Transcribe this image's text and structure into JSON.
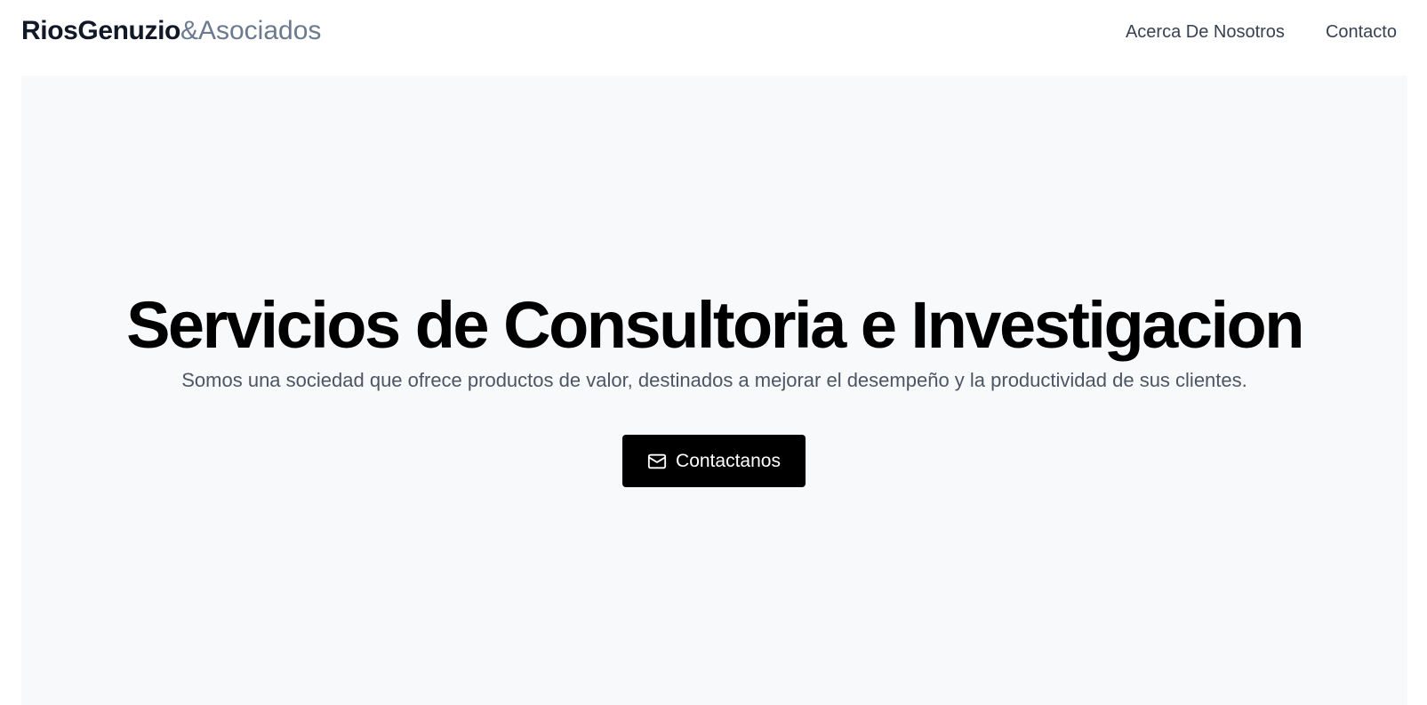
{
  "header": {
    "logo_bold": "RiosGenuzio",
    "logo_light": "&Asociados",
    "nav": [
      {
        "label": "Acerca De Nosotros"
      },
      {
        "label": "Contacto"
      }
    ]
  },
  "hero": {
    "title": "Servicios de Consultoria e Investigacion",
    "subtitle": "Somos una sociedad que ofrece productos de valor, destinados a mejorar el desempeño y la productividad de sus clientes.",
    "cta_label": "Contactanos",
    "cta_icon": "mail-icon"
  },
  "colors": {
    "hero_background": "#f8f9fb",
    "button_background": "#000000",
    "logo_light": "#6b7a8f"
  }
}
